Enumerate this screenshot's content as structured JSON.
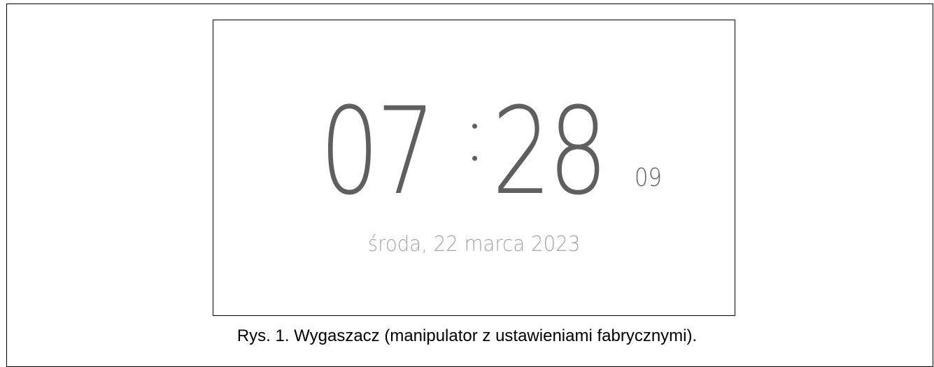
{
  "screen": {
    "time": {
      "hours": "07",
      "minutes": "28",
      "seconds": "09"
    },
    "date": "środa, 22 marca 2023"
  },
  "caption": "Rys. 1. Wygaszacz (manipulator z ustawieniami fabrycznymi).",
  "colors": {
    "clock_digits": "#5f5f5f",
    "date_text": "#a4a4a4",
    "frame_border": "#000000",
    "background": "#ffffff"
  }
}
